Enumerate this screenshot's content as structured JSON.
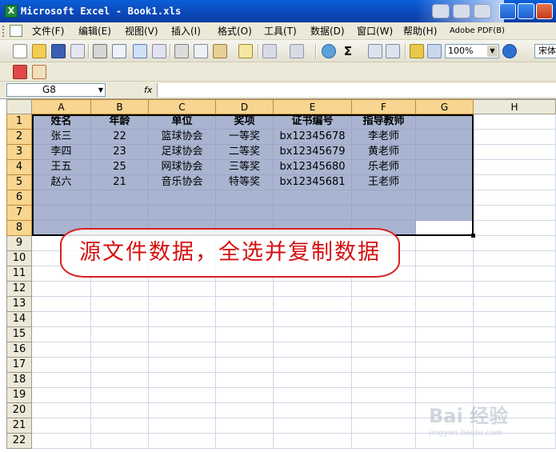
{
  "window": {
    "title": "Microsoft Excel - Book1.xls"
  },
  "menu": [
    "文件(F)",
    "编辑(E)",
    "视图(V)",
    "插入(I)",
    "格式(O)",
    "工具(T)",
    "数据(D)",
    "窗口(W)",
    "帮助(H)",
    "Adobe PDF(B)"
  ],
  "toolbar": {
    "zoom": "100%",
    "font": "宋体"
  },
  "formula_bar": {
    "name_box": "G8",
    "fx_label": "fx",
    "formula": ""
  },
  "sheet": {
    "columns": [
      "A",
      "B",
      "C",
      "D",
      "E",
      "F",
      "G",
      "H"
    ],
    "rows": [
      "1",
      "2",
      "3",
      "4",
      "5",
      "6",
      "7",
      "8",
      "9",
      "10",
      "11",
      "12",
      "13",
      "14",
      "15",
      "16",
      "17",
      "18",
      "19",
      "20",
      "21",
      "22"
    ],
    "header_row": [
      "姓名",
      "年龄",
      "单位",
      "奖项",
      "证书编号",
      "指导教师"
    ],
    "data_rows": [
      [
        "张三",
        "22",
        "篮球协会",
        "一等奖",
        "bx12345678",
        "李老师"
      ],
      [
        "李四",
        "23",
        "足球协会",
        "二等奖",
        "bx12345679",
        "黄老师"
      ],
      [
        "王五",
        "25",
        "网球协会",
        "三等奖",
        "bx12345680",
        "乐老师"
      ],
      [
        "赵六",
        "21",
        "音乐协会",
        "特等奖",
        "bx12345681",
        "王老师"
      ]
    ],
    "selection": "A1:G8",
    "active_cell": "G8"
  },
  "annotation": "源文件数据，全选并复制数据",
  "watermark": {
    "main": "Bai 经验",
    "sub": "jingyan.baidu.com"
  },
  "colors": {
    "selection_fill": "#a8b4d0",
    "annotation_red": "#d41010",
    "title_blue": "#0b48b8"
  }
}
